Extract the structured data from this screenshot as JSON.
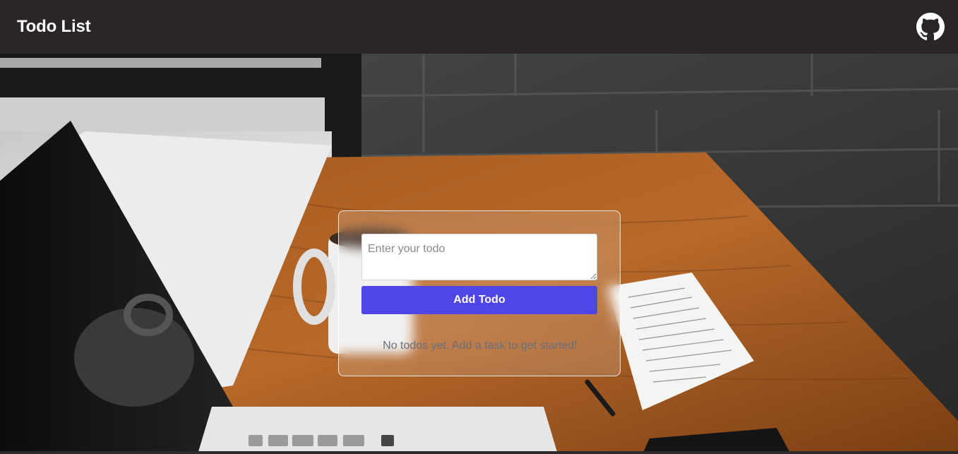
{
  "navbar": {
    "title": "Todo List",
    "github_icon": "github-icon"
  },
  "todo_form": {
    "placeholder": "Enter your todo",
    "value": "",
    "add_label": "Add Todo"
  },
  "todo_list": {
    "items": [],
    "empty_message": "No todos yet. Add a task to get started!"
  },
  "colors": {
    "navbar_bg": "#2a2625",
    "accent": "#4f46e5",
    "title_text": "#ffffff"
  },
  "background_image": "desk-with-laptop-coffee-mug-and-notes-photo"
}
